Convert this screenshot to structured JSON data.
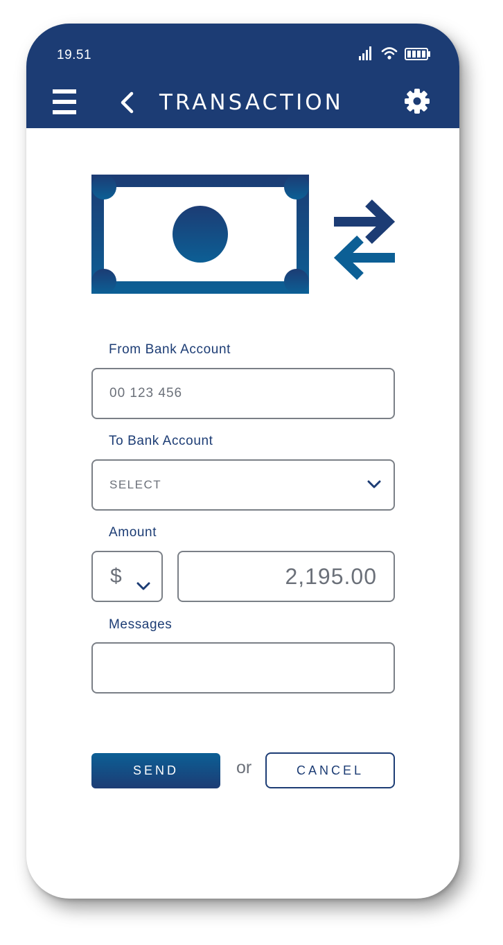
{
  "status_bar": {
    "time": "19.51"
  },
  "app_bar": {
    "title": "TRANSACTION"
  },
  "form": {
    "from_label": "From Bank Account",
    "from_value": "00 123 456",
    "to_label": "To Bank Account",
    "to_value": "SELECT",
    "amount_label": "Amount",
    "currency_value": "$",
    "amount_value": "2,195.00",
    "messages_label": "Messages",
    "messages_value": ""
  },
  "actions": {
    "send_label": "SEND",
    "or_label": "or",
    "cancel_label": "CANCEL"
  },
  "colors": {
    "header": "#1c3c74",
    "accent_dark": "#1c3c74",
    "accent_light": "#0c5f95",
    "text_label": "#1c3c74",
    "field_border": "#7a7f86",
    "field_text": "#6b7079"
  },
  "icons": {
    "signal": "signal-icon",
    "wifi": "wifi-icon",
    "battery": "battery-icon",
    "menu": "menu-icon",
    "back": "back-arrow-icon",
    "settings": "gear-icon",
    "money": "banknote-icon",
    "transfer": "transfer-arrows-icon",
    "dropdown": "chevron-down-icon"
  }
}
